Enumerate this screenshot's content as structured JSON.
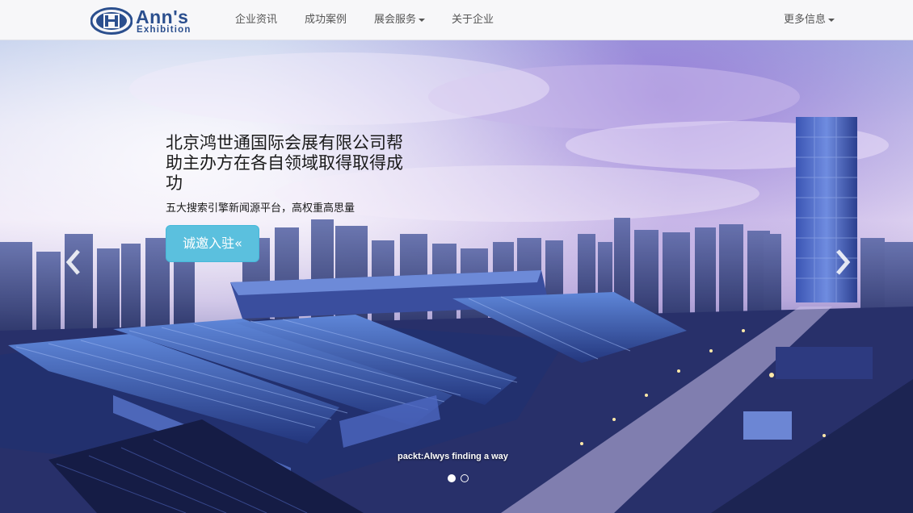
{
  "brand": {
    "logo_text": "Ann's",
    "logo_sub": "Exhibition",
    "monogram": "H",
    "color": "#2b4f8e"
  },
  "nav": {
    "items": [
      {
        "label": "企业资讯"
      },
      {
        "label": "成功案例"
      },
      {
        "label": "展会服务",
        "dropdown": true
      },
      {
        "label": "关于企业"
      }
    ],
    "more": {
      "label": "更多信息",
      "dropdown": true
    }
  },
  "hero": {
    "headline_lines": [
      "北京鸿世通国际会展有限公司帮",
      "助主办方在各自领域取得取得成",
      "功"
    ],
    "subtitle": "五大搜索引擎新闻源平台，高权重高思量",
    "cta_label": "诚邀入驻«",
    "tagline": "packt:Alwys finding a way",
    "slide_count": 2,
    "active_slide": 1,
    "prev_icon": "chevron-left-icon",
    "next_icon": "chevron-right-icon",
    "cta_color": "#5bc0de"
  }
}
